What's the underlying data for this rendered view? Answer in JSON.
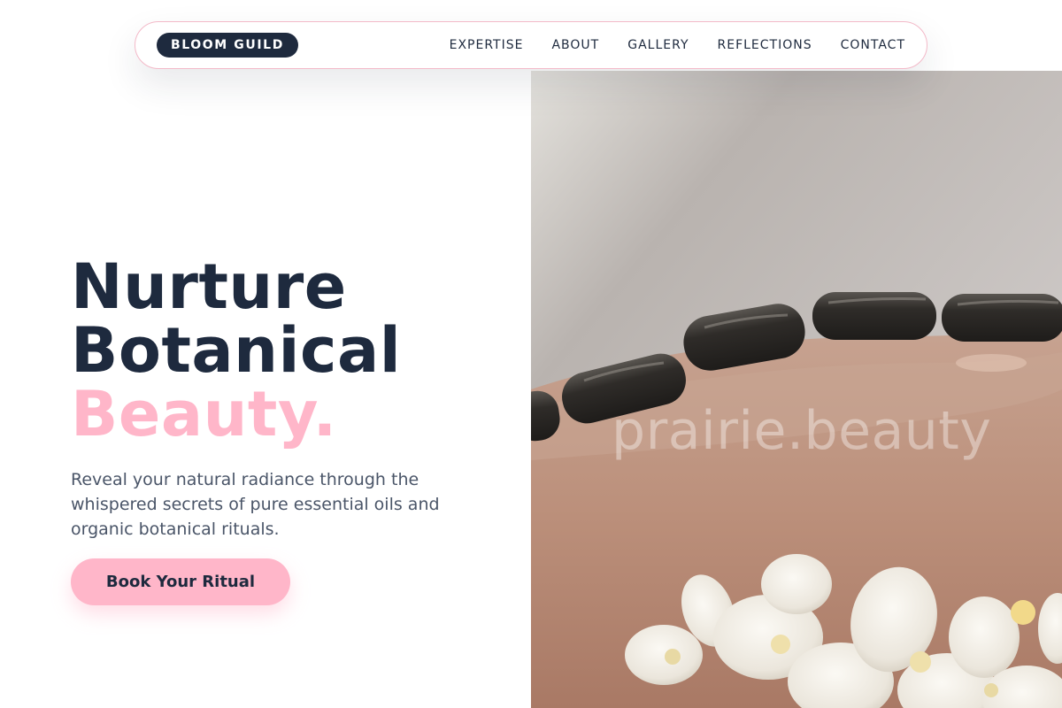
{
  "nav": {
    "brand": "BLOOM GUILD",
    "links": [
      "EXPERTISE",
      "ABOUT",
      "GALLERY",
      "REFLECTIONS",
      "CONTACT"
    ]
  },
  "hero": {
    "title_line1": "Nurture",
    "title_line2": "Botanical",
    "title_accent": "Beauty.",
    "description": "Reveal your natural radiance through the whispered secrets of pure essential oils and organic botanical rituals.",
    "cta_label": "Book Your Ritual",
    "image_watermark": "prairie.beauty"
  },
  "colors": {
    "navy": "#1e2a3e",
    "pink": "#ffb6c9",
    "body_text": "#4a5568",
    "nav_border": "#f3b9c8"
  }
}
